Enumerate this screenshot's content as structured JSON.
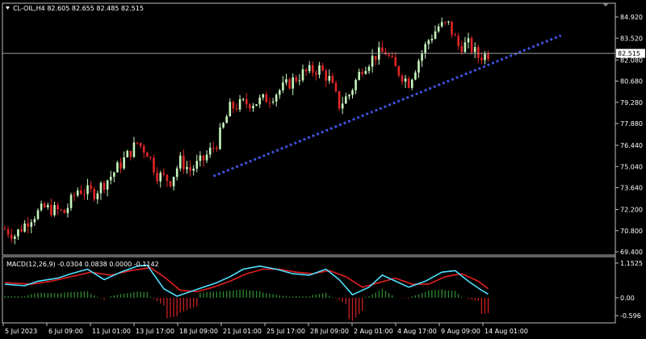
{
  "main": {
    "symbol_header": "CL-OIL,H4  82.605 82.655 82.485 82.515",
    "price_ticks": [
      "84.920",
      "83.520",
      "82.080",
      "80.680",
      "79.280",
      "77.880",
      "76.440",
      "75.040",
      "73.640",
      "72.200",
      "70.800",
      "69.400"
    ],
    "current_price": "82.515"
  },
  "macd": {
    "header": "MACD(12,26,9) -0.0304 0.0838 0.0000 -0.1142",
    "ticks": [
      "1.1525",
      "0.00",
      "-0.596"
    ]
  },
  "time_ticks": [
    "5 Jul 2023",
    "6 Jul 09:00",
    "11 Jul 01:00",
    "13 Jul 17:00",
    "18 Jul 09:00",
    "21 Jul 01:00",
    "25 Jul 17:00",
    "28 Jul 09:00",
    "2 Aug 01:00",
    "4 Aug 17:00",
    "9 Aug 09:00",
    "14 Aug 01:00"
  ],
  "colors": {
    "background": "#000000",
    "bull_candle": "#c6f5bc",
    "bear_candle": "#e02626",
    "trendline": "#3f51d9",
    "macd_line": "#4fe0ff",
    "signal_line": "#e01f1f",
    "hist_pos": "#2e8b2e",
    "hist_neg": "#c82020",
    "grid_border": "#bfbfbf",
    "price_line": "#a0a0a0"
  },
  "chart_data": [
    {
      "type": "candlestick",
      "symbol": "CL-OIL",
      "timeframe": "H4",
      "ohlc_last": {
        "open": 82.605,
        "high": 82.655,
        "low": 82.485,
        "close": 82.515
      },
      "ylim": [
        69.4,
        85.2
      ],
      "close_path": [
        {
          "x": 0,
          "y": 70.9
        },
        {
          "x": 3,
          "y": 70.5
        },
        {
          "x": 8,
          "y": 71.7
        },
        {
          "x": 12,
          "y": 72.3
        },
        {
          "x": 18,
          "y": 72.0
        },
        {
          "x": 22,
          "y": 73.5
        },
        {
          "x": 27,
          "y": 73.3
        },
        {
          "x": 32,
          "y": 74.4
        },
        {
          "x": 36,
          "y": 75.5
        },
        {
          "x": 40,
          "y": 76.6
        },
        {
          "x": 43,
          "y": 76.0
        },
        {
          "x": 46,
          "y": 74.5
        },
        {
          "x": 50,
          "y": 74.1
        },
        {
          "x": 53,
          "y": 75.4
        },
        {
          "x": 56,
          "y": 74.8
        },
        {
          "x": 60,
          "y": 75.5
        },
        {
          "x": 64,
          "y": 76.6
        },
        {
          "x": 68,
          "y": 78.9
        },
        {
          "x": 72,
          "y": 79.2
        },
        {
          "x": 76,
          "y": 79.3
        },
        {
          "x": 80,
          "y": 79.6
        },
        {
          "x": 85,
          "y": 80.4
        },
        {
          "x": 90,
          "y": 81.2
        },
        {
          "x": 95,
          "y": 81.5
        },
        {
          "x": 98,
          "y": 80.8
        },
        {
          "x": 101,
          "y": 79.1
        },
        {
          "x": 104,
          "y": 79.8
        },
        {
          "x": 108,
          "y": 81.6
        },
        {
          "x": 112,
          "y": 82.4
        },
        {
          "x": 115,
          "y": 82.6
        },
        {
          "x": 118,
          "y": 81.5
        },
        {
          "x": 122,
          "y": 80.6
        },
        {
          "x": 125,
          "y": 82.1
        },
        {
          "x": 128,
          "y": 83.4
        },
        {
          "x": 131,
          "y": 84.3
        },
        {
          "x": 134,
          "y": 84.4
        },
        {
          "x": 137,
          "y": 83.0
        },
        {
          "x": 140,
          "y": 83.1
        },
        {
          "x": 143,
          "y": 82.3
        },
        {
          "x": 146,
          "y": 82.5
        }
      ],
      "trendline": [
        {
          "x": 63,
          "y": 74.4
        },
        {
          "x": 168,
          "y": 83.7
        }
      ],
      "current_price": 82.515
    },
    {
      "type": "line",
      "title": "MACD(12,26,9)",
      "values_header": [
        -0.0304,
        0.0838,
        0.0,
        -0.1142
      ],
      "ylim": [
        -0.62,
        1.15
      ],
      "series": [
        {
          "name": "MACD",
          "points": [
            {
              "x": 0,
              "y": 0.45
            },
            {
              "x": 6,
              "y": 0.4
            },
            {
              "x": 10,
              "y": 0.55
            },
            {
              "x": 16,
              "y": 0.65
            },
            {
              "x": 20,
              "y": 0.8
            },
            {
              "x": 25,
              "y": 0.95
            },
            {
              "x": 30,
              "y": 0.6
            },
            {
              "x": 35,
              "y": 0.85
            },
            {
              "x": 40,
              "y": 1.05
            },
            {
              "x": 43,
              "y": 1.08
            },
            {
              "x": 48,
              "y": 0.3
            },
            {
              "x": 52,
              "y": 0.05
            },
            {
              "x": 56,
              "y": 0.2
            },
            {
              "x": 60,
              "y": 0.35
            },
            {
              "x": 64,
              "y": 0.5
            },
            {
              "x": 68,
              "y": 0.7
            },
            {
              "x": 72,
              "y": 0.95
            },
            {
              "x": 77,
              "y": 1.05
            },
            {
              "x": 82,
              "y": 0.95
            },
            {
              "x": 87,
              "y": 0.8
            },
            {
              "x": 92,
              "y": 0.75
            },
            {
              "x": 97,
              "y": 0.95
            },
            {
              "x": 101,
              "y": 0.6
            },
            {
              "x": 105,
              "y": 0.1
            },
            {
              "x": 110,
              "y": 0.35
            },
            {
              "x": 114,
              "y": 0.75
            },
            {
              "x": 118,
              "y": 0.55
            },
            {
              "x": 122,
              "y": 0.35
            },
            {
              "x": 127,
              "y": 0.55
            },
            {
              "x": 132,
              "y": 0.85
            },
            {
              "x": 136,
              "y": 0.9
            },
            {
              "x": 140,
              "y": 0.55
            },
            {
              "x": 144,
              "y": 0.25
            },
            {
              "x": 146,
              "y": 0.12
            }
          ]
        },
        {
          "name": "Signal",
          "points": [
            {
              "x": 0,
              "y": 0.5
            },
            {
              "x": 8,
              "y": 0.45
            },
            {
              "x": 14,
              "y": 0.55
            },
            {
              "x": 20,
              "y": 0.7
            },
            {
              "x": 26,
              "y": 0.85
            },
            {
              "x": 32,
              "y": 0.75
            },
            {
              "x": 38,
              "y": 0.9
            },
            {
              "x": 44,
              "y": 1.0
            },
            {
              "x": 48,
              "y": 0.7
            },
            {
              "x": 53,
              "y": 0.25
            },
            {
              "x": 58,
              "y": 0.2
            },
            {
              "x": 63,
              "y": 0.35
            },
            {
              "x": 68,
              "y": 0.55
            },
            {
              "x": 73,
              "y": 0.8
            },
            {
              "x": 78,
              "y": 0.95
            },
            {
              "x": 83,
              "y": 0.95
            },
            {
              "x": 88,
              "y": 0.85
            },
            {
              "x": 93,
              "y": 0.8
            },
            {
              "x": 98,
              "y": 0.9
            },
            {
              "x": 103,
              "y": 0.7
            },
            {
              "x": 108,
              "y": 0.35
            },
            {
              "x": 113,
              "y": 0.5
            },
            {
              "x": 118,
              "y": 0.65
            },
            {
              "x": 123,
              "y": 0.45
            },
            {
              "x": 128,
              "y": 0.45
            },
            {
              "x": 133,
              "y": 0.7
            },
            {
              "x": 138,
              "y": 0.8
            },
            {
              "x": 143,
              "y": 0.55
            },
            {
              "x": 146,
              "y": 0.3
            }
          ]
        }
      ]
    }
  ]
}
